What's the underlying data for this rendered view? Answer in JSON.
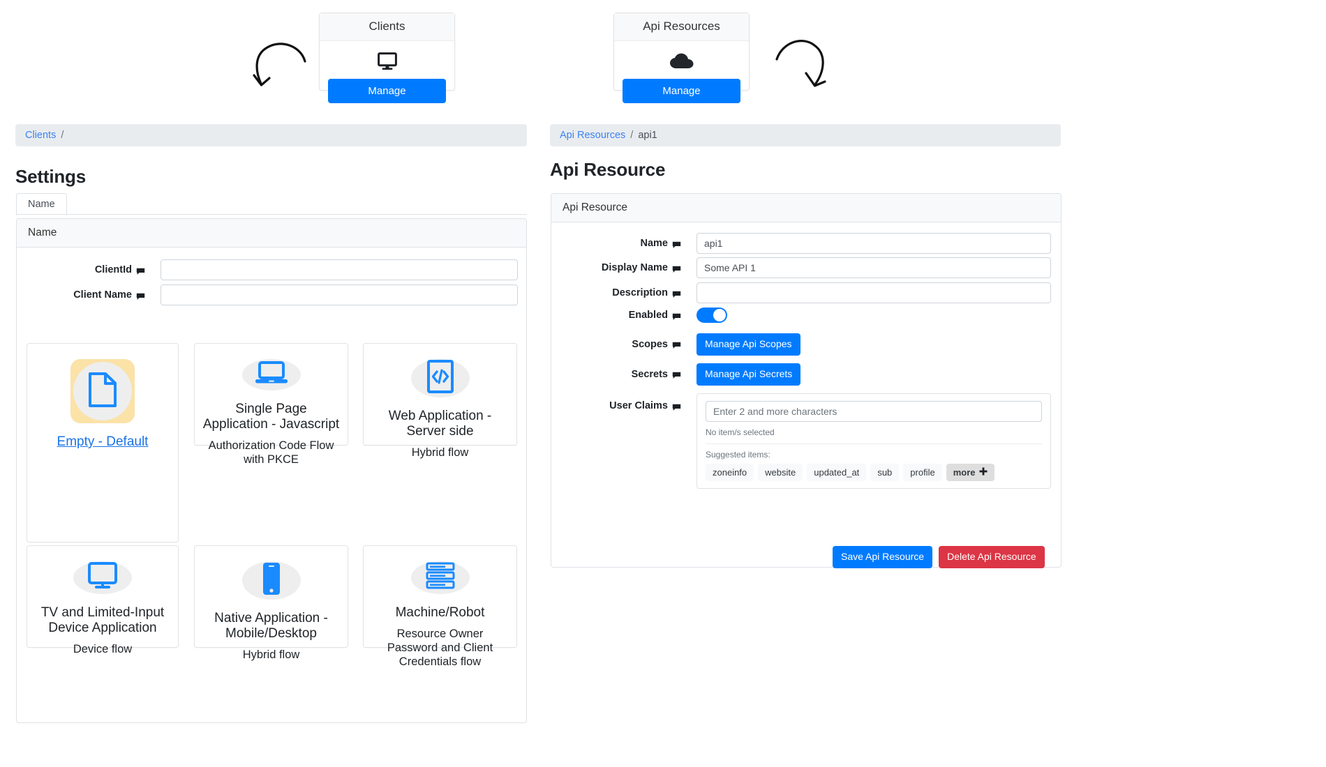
{
  "dashboard": {
    "tiles": [
      {
        "title": "Clients",
        "icon": "desktop-monitor-icon",
        "button": "Manage"
      },
      {
        "title": "Api Resources",
        "icon": "cloud-icon",
        "button": "Manage"
      }
    ]
  },
  "left": {
    "breadcrumb": {
      "root": "Clients",
      "separator": "/"
    },
    "page_title": "Settings",
    "tabs": [
      {
        "label": "Name",
        "active": true
      }
    ],
    "card_header": "Name",
    "fields": [
      {
        "label": "ClientId",
        "value": "",
        "placeholder": ""
      },
      {
        "label": "Client Name",
        "value": "",
        "placeholder": ""
      }
    ],
    "client_types": [
      {
        "id": "empty-default",
        "link": "Empty - Default",
        "title": "",
        "sub": "",
        "icon": "file-document-icon",
        "highlighted": true
      },
      {
        "id": "single-page-app",
        "title": "Single Page Application - Javascript",
        "sub": "Authorization Code Flow with PKCE",
        "icon": "laptop-icon",
        "highlighted": false
      },
      {
        "id": "web-app-server-side",
        "title": "Web Application - Server side",
        "sub": "Hybrid flow",
        "icon": "code-file-icon",
        "highlighted": false
      },
      {
        "id": "tv-limited-input",
        "title": "TV and Limited-Input Device Application",
        "sub": "Device flow",
        "icon": "tv-monitor-icon",
        "highlighted": false
      },
      {
        "id": "native-app",
        "title": "Native Application - Mobile/Desktop",
        "sub": "Hybrid flow",
        "icon": "mobile-phone-icon",
        "highlighted": false
      },
      {
        "id": "machine-robot",
        "title": "Machine/Robot",
        "sub": "Resource Owner Password and Client Credentials flow",
        "icon": "server-stack-icon",
        "highlighted": false
      }
    ]
  },
  "right": {
    "breadcrumb": {
      "root": "Api Resources",
      "separator": "/",
      "current": "api1"
    },
    "page_title": "Api Resource",
    "card_header": "Api Resource",
    "fields": {
      "name": {
        "label": "Name",
        "value": "api1"
      },
      "display_name": {
        "label": "Display Name",
        "value": "Some API 1"
      },
      "description": {
        "label": "Description",
        "value": ""
      },
      "enabled": {
        "label": "Enabled",
        "on": true
      },
      "scopes": {
        "label": "Scopes",
        "button": "Manage Api Scopes"
      },
      "secrets": {
        "label": "Secrets",
        "button": "Manage Api Secrets"
      },
      "user_claims": {
        "label": "User Claims",
        "placeholder": "Enter 2 and more characters",
        "value": "",
        "selected_note": "No item/s selected",
        "suggested_label": "Suggested items:",
        "suggested": [
          "zoneinfo",
          "website",
          "updated_at",
          "sub",
          "profile"
        ],
        "more_label": "more"
      }
    },
    "actions": {
      "save": "Save Api Resource",
      "delete": "Delete Api Resource"
    }
  },
  "colors": {
    "primary": "#007bff",
    "danger": "#dc3545",
    "link": "#3b82f6",
    "icon_blue": "#1a8bff",
    "highlight": "#fbe2a7",
    "breadcrumb_bg": "#e9ecef"
  }
}
